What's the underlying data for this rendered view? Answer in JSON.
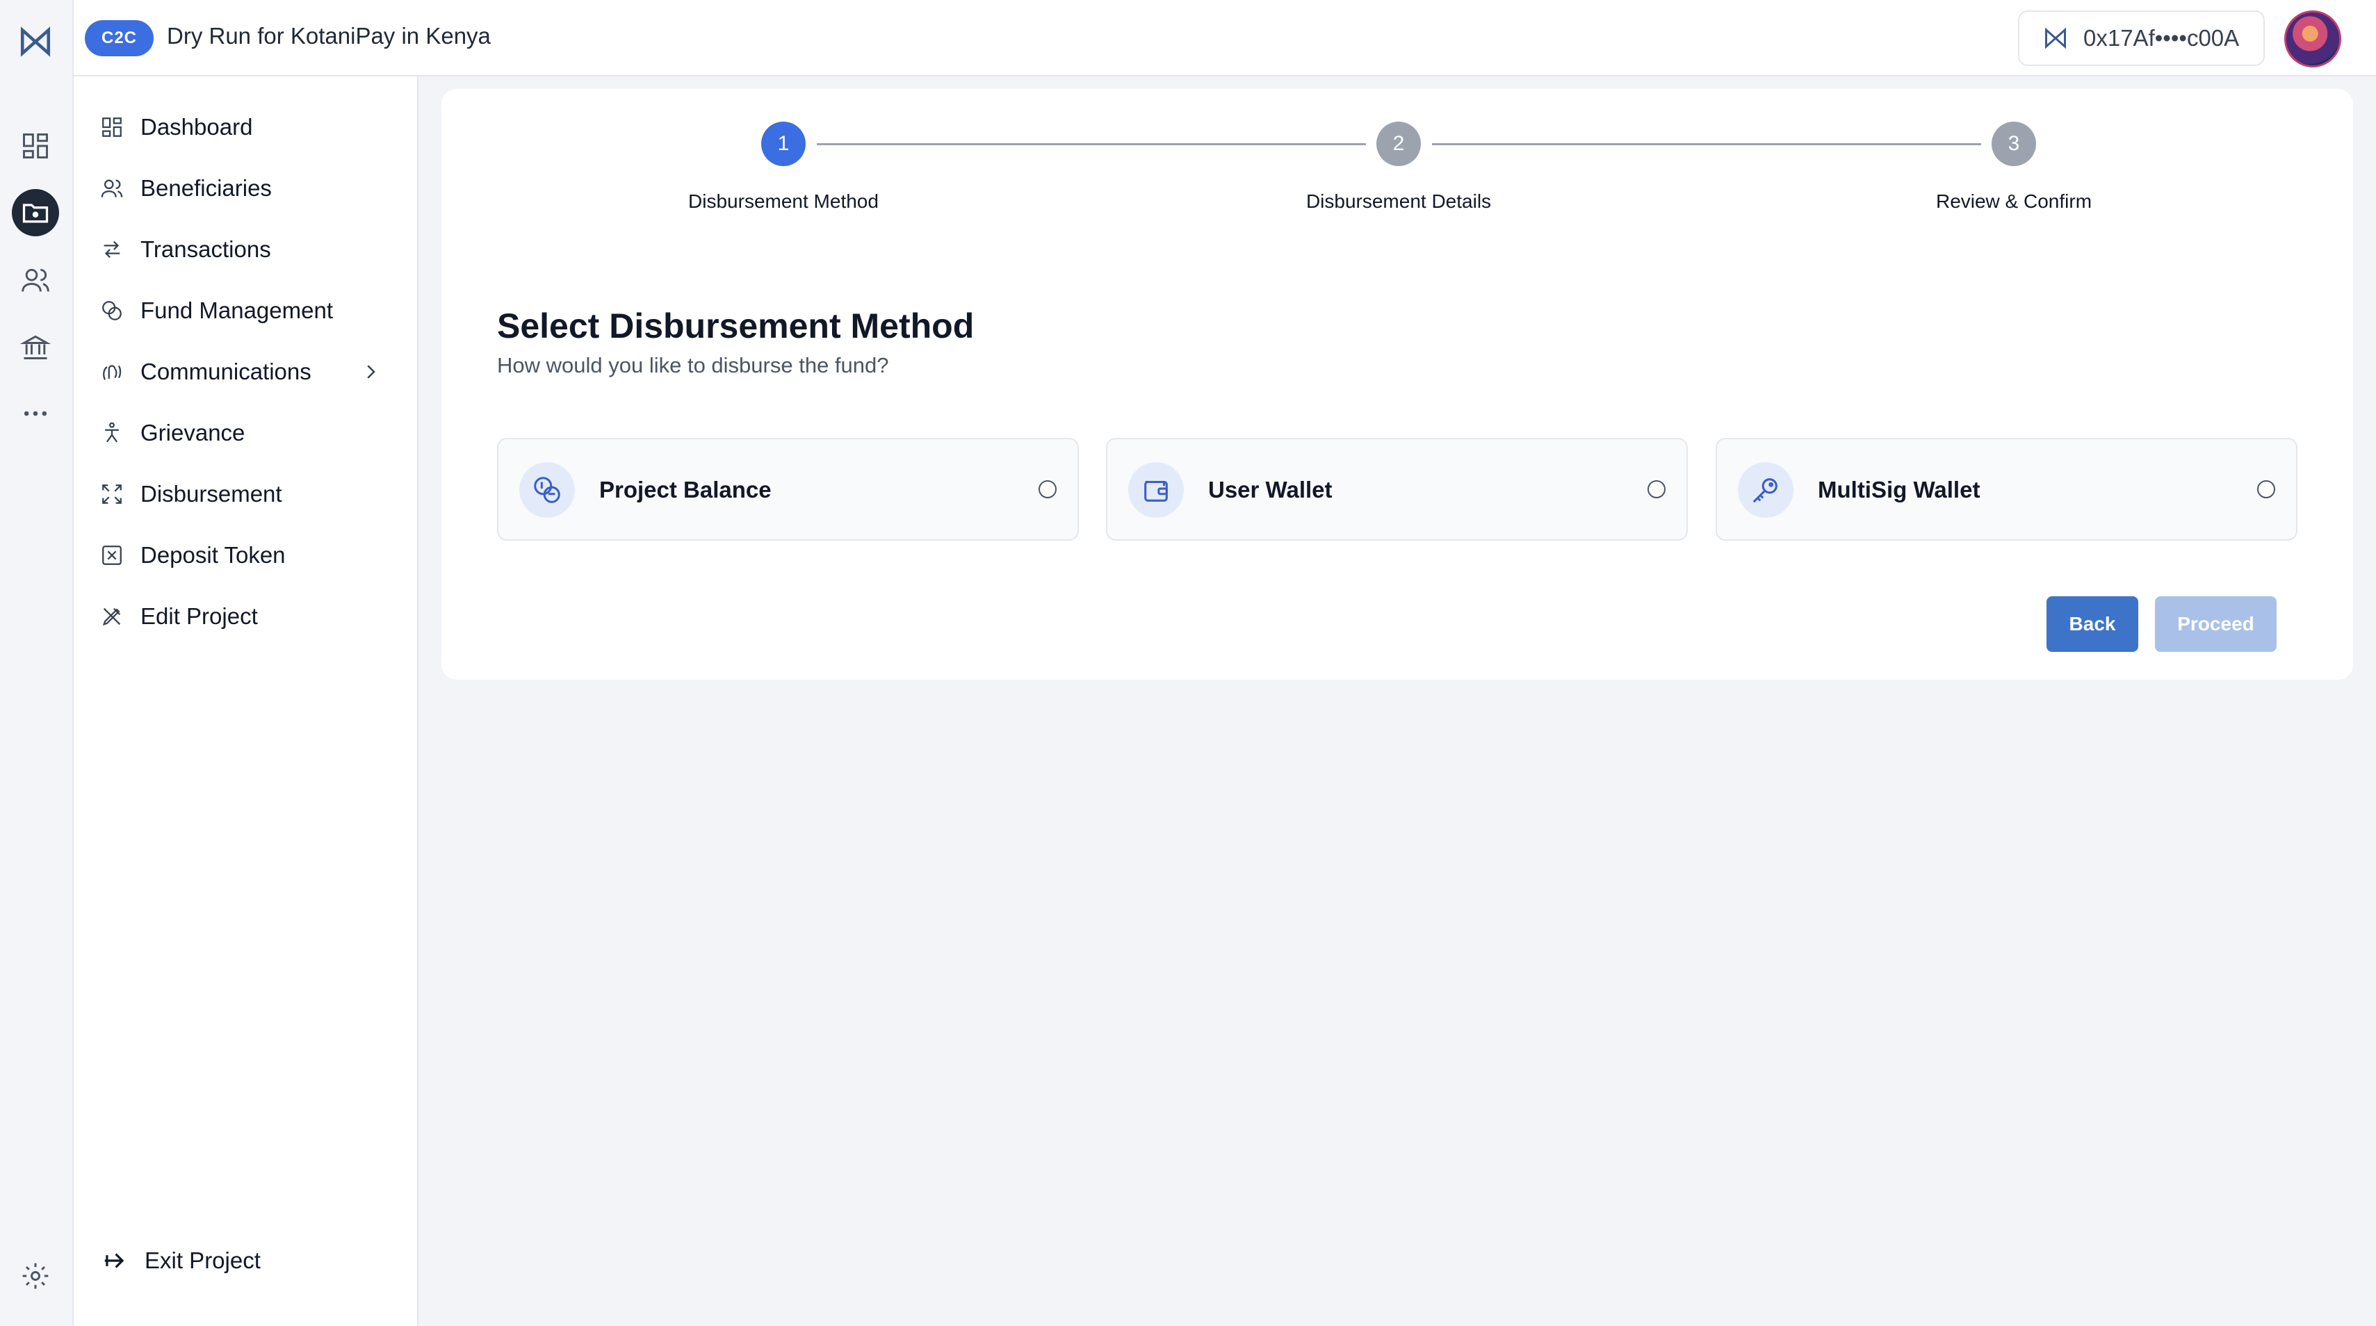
{
  "header": {
    "badge": "C2C",
    "project_title": "Dry Run for KotaniPay in Kenya",
    "wallet_address": "0x17Af••••c00A"
  },
  "rail": {
    "icons": [
      "logo-icon",
      "grid-icon",
      "folder-icon",
      "users-icon",
      "bank-icon",
      "more-icon",
      "settings-icon"
    ],
    "active": "folder-icon"
  },
  "sidebar": {
    "items": [
      {
        "label": "Dashboard",
        "icon": "dashboard-icon"
      },
      {
        "label": "Beneficiaries",
        "icon": "beneficiaries-icon"
      },
      {
        "label": "Transactions",
        "icon": "transactions-icon"
      },
      {
        "label": "Fund Management",
        "icon": "fund-icon"
      },
      {
        "label": "Communications",
        "icon": "communications-icon"
      },
      {
        "label": "Grievance",
        "icon": "grievance-icon"
      },
      {
        "label": "Disbursement",
        "icon": "disbursement-icon"
      },
      {
        "label": "Deposit Token",
        "icon": "deposit-icon"
      },
      {
        "label": "Edit Project",
        "icon": "edit-icon"
      }
    ],
    "exit_label": "Exit Project"
  },
  "stepper": {
    "steps": [
      {
        "number": "1",
        "label": "Disbursement Method",
        "state": "active"
      },
      {
        "number": "2",
        "label": "Disbursement Details",
        "state": "pending"
      },
      {
        "number": "3",
        "label": "Review & Confirm",
        "state": "pending"
      }
    ],
    "active_color": "#3b6ee0",
    "pending_color": "#9ca3af"
  },
  "main": {
    "heading": "Select Disbursement Method",
    "subheading": "How would you like to disburse the fund?",
    "options": [
      {
        "label": "Project Balance",
        "icon": "coins-icon",
        "selected": false
      },
      {
        "label": "User Wallet",
        "icon": "wallet-icon",
        "selected": false
      },
      {
        "label": "MultiSig Wallet",
        "icon": "key-icon",
        "selected": false
      }
    ],
    "back_label": "Back",
    "proceed_label": "Proceed"
  }
}
